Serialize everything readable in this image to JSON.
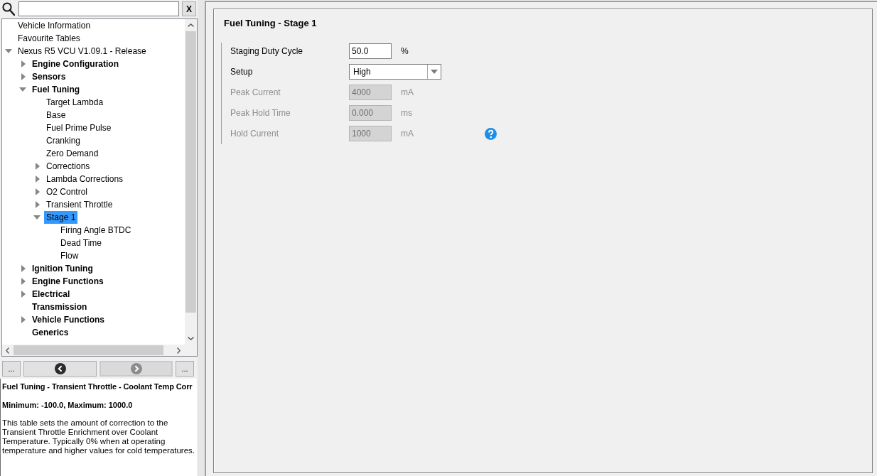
{
  "sidebar": {
    "search": {
      "clear_button": "X"
    },
    "tree": [
      {
        "label": "Vehicle Information",
        "selected": false
      },
      {
        "label": "Favourite Tables",
        "selected": false
      },
      {
        "label": "Nexus R5 VCU V1.09.1 - Release",
        "selected": false,
        "expanded": true,
        "children": [
          {
            "label": "Engine Configuration",
            "selected": false,
            "expanded": false
          },
          {
            "label": "Sensors",
            "selected": false,
            "expanded": false
          },
          {
            "label": "Fuel Tuning",
            "selected": false,
            "expanded": true,
            "children": [
              {
                "label": "Target Lambda",
                "selected": false
              },
              {
                "label": "Base",
                "selected": false
              },
              {
                "label": "Fuel Prime Pulse",
                "selected": false
              },
              {
                "label": "Cranking",
                "selected": false
              },
              {
                "label": "Zero Demand",
                "selected": false
              },
              {
                "label": "Corrections",
                "selected": false,
                "expanded": false
              },
              {
                "label": "Lambda Corrections",
                "selected": false,
                "expanded": false
              },
              {
                "label": "O2 Control",
                "selected": false,
                "expanded": false
              },
              {
                "label": "Transient Throttle",
                "selected": false,
                "expanded": false
              },
              {
                "label": "Stage 1",
                "selected": true,
                "expanded": true,
                "children": [
                  {
                    "label": "Firing Angle BTDC",
                    "selected": false
                  },
                  {
                    "label": "Dead Time",
                    "selected": false
                  },
                  {
                    "label": "Flow",
                    "selected": false
                  }
                ]
              }
            ]
          },
          {
            "label": "Ignition Tuning",
            "selected": false,
            "expanded": false
          },
          {
            "label": "Engine Functions",
            "selected": false,
            "expanded": false
          },
          {
            "label": "Electrical",
            "selected": false,
            "expanded": false
          },
          {
            "label": "Transmission",
            "selected": false
          },
          {
            "label": "Vehicle Functions",
            "selected": false,
            "expanded": false
          },
          {
            "label": "Generics",
            "selected": false
          }
        ]
      }
    ],
    "nav_buttons": [
      {
        "kind": "more",
        "label": "...",
        "disabled": false
      },
      {
        "kind": "back",
        "disabled": false
      },
      {
        "kind": "forward",
        "disabled": true
      },
      {
        "kind": "more",
        "label": "...",
        "disabled": false
      }
    ],
    "help": {
      "title": "Fuel Tuning - Transient Throttle - Coolant Temp Corr",
      "range": "Minimum: -100.0, Maximum: 1000.0",
      "text": "This table sets the amount of correction to the Transient Throttle Enrichment over Coolant Temperature. Typically 0% when at operating temperature and higher values for cold temperatures."
    }
  },
  "page": {
    "title": "Fuel Tuning - Stage 1",
    "fields": [
      {
        "kind": "number",
        "label": "Staging Duty Cycle",
        "value": "50.0",
        "unit": "%",
        "disabled": false
      },
      {
        "kind": "dropdown",
        "label": "Setup",
        "value": "High",
        "disabled": false
      },
      {
        "kind": "number",
        "label": "Peak Current",
        "value": "4000",
        "unit": "mA",
        "disabled": true
      },
      {
        "kind": "number",
        "label": "Peak Hold Time",
        "value": "0.000",
        "unit": "ms",
        "disabled": true
      },
      {
        "kind": "number",
        "label": "Hold Current",
        "value": "1000",
        "unit": "mA",
        "disabled": true,
        "help": true
      }
    ]
  }
}
